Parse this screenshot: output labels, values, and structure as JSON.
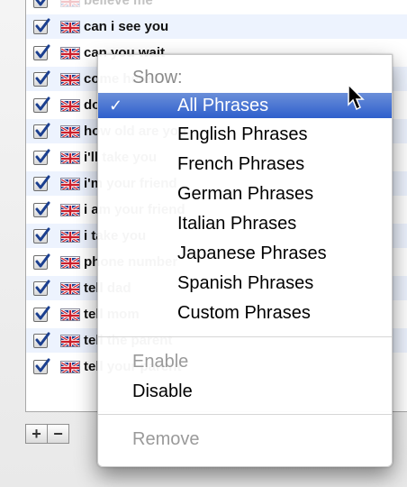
{
  "phrase_list": {
    "rows": [
      {
        "label": "believe me",
        "checked": true,
        "faded": true
      },
      {
        "label": "can i see you",
        "checked": true,
        "faded": false
      },
      {
        "label": "can you wait",
        "checked": true,
        "faded": false
      },
      {
        "label": "come here",
        "checked": true,
        "faded": false
      },
      {
        "label": "don't tell the parent",
        "checked": true,
        "faded": false
      },
      {
        "label": "how old are you",
        "checked": true,
        "faded": false
      },
      {
        "label": "i'll take you",
        "checked": true,
        "faded": false
      },
      {
        "label": "i'm your friend",
        "checked": true,
        "faded": false
      },
      {
        "label": "i am your friend",
        "checked": true,
        "faded": false
      },
      {
        "label": "i take you",
        "checked": true,
        "faded": false
      },
      {
        "label": "phone number",
        "checked": true,
        "faded": false
      },
      {
        "label": "tell dad",
        "checked": true,
        "faded": false
      },
      {
        "label": "tell mom",
        "checked": true,
        "faded": false
      },
      {
        "label": "tell the parent",
        "checked": true,
        "faded": false
      },
      {
        "label": "tell your parent",
        "checked": true,
        "faded": false
      }
    ]
  },
  "buttons": {
    "add": "+",
    "remove": "−"
  },
  "menu": {
    "header": "Show:",
    "options": [
      {
        "label": "All Phrases",
        "selected": true
      },
      {
        "label": "English Phrases",
        "selected": false
      },
      {
        "label": "French Phrases",
        "selected": false
      },
      {
        "label": "German Phrases",
        "selected": false
      },
      {
        "label": "Italian Phrases",
        "selected": false
      },
      {
        "label": "Japanese Phrases",
        "selected": false
      },
      {
        "label": "Spanish Phrases",
        "selected": false
      },
      {
        "label": "Custom Phrases",
        "selected": false
      }
    ],
    "checkmark": "✓",
    "enable": "Enable",
    "disable": "Disable",
    "remove": "Remove"
  },
  "colors": {
    "selection": "#3a67d0",
    "row_alt": "#edf3fe"
  }
}
